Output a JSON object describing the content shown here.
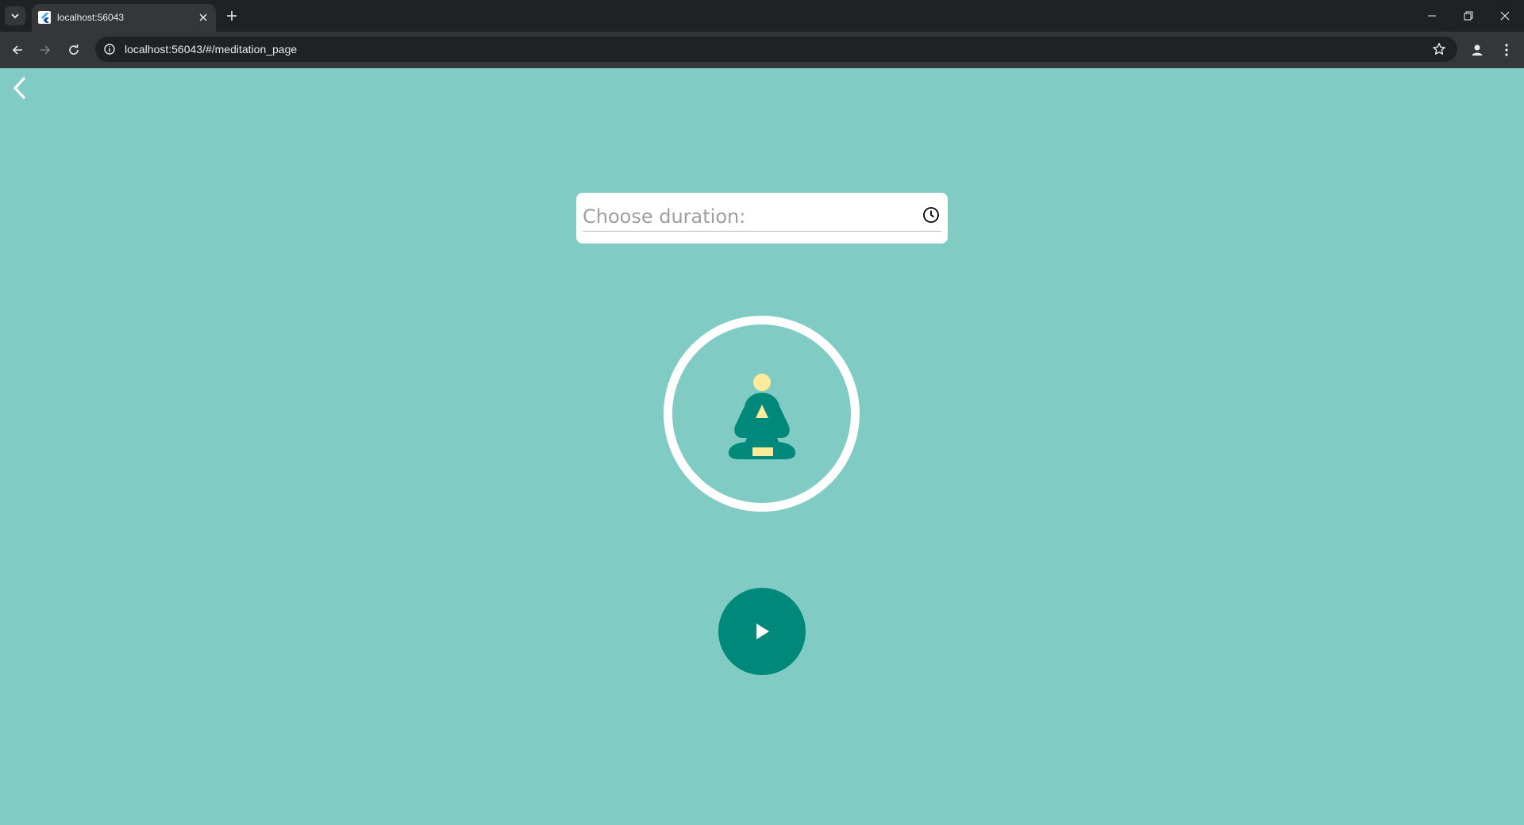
{
  "browser": {
    "tab_title": "localhost:56043",
    "url": "localhost:56043/#/meditation_page",
    "icons": {
      "tab_search": "chevron-down-icon",
      "favicon": "flutter-logo-icon",
      "tab_close": "close-icon",
      "new_tab": "plus-icon",
      "minimize": "minimize-icon",
      "restore": "restore-icon",
      "close_window": "close-icon",
      "back": "arrow-left-icon",
      "forward": "arrow-right-icon",
      "reload": "reload-icon",
      "site_info": "info-icon",
      "bookmark": "star-icon",
      "profile": "person-icon",
      "menu": "kebab-menu-icon"
    }
  },
  "app": {
    "background_color": "#80cbc4",
    "accent_color": "#00897b",
    "back_icon": "chevron-left-icon",
    "duration_field": {
      "placeholder": "Choose duration:",
      "icon": "clock-icon"
    },
    "illustration": "meditation-figure-icon",
    "play_icon": "play-icon"
  }
}
